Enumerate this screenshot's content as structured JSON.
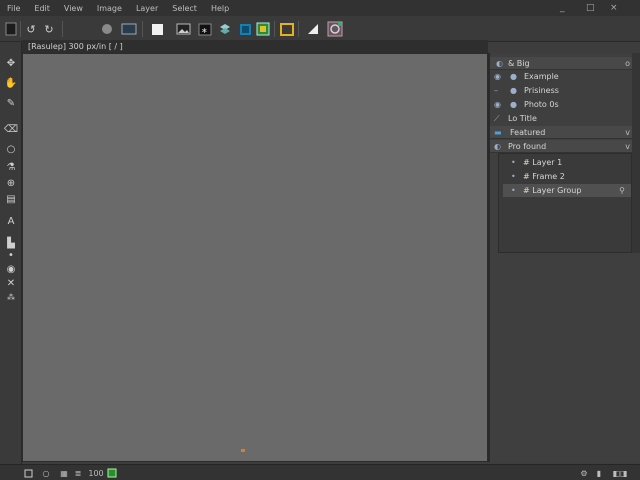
{
  "menubar": {
    "items": [
      "File",
      "Edit",
      "View",
      "Image",
      "Layer",
      "Select",
      "Help"
    ],
    "window_controls": {
      "minimize": "_",
      "maximize": "□",
      "close": "×"
    }
  },
  "toolbar": {
    "icons": [
      "document-icon",
      "undo-icon",
      "redo-icon",
      "sphere-icon",
      "monitor-icon",
      "white-square-icon",
      "image-icon",
      "film-icon",
      "layers-icon",
      "frame-icon",
      "gallery-icon",
      "cursor-icon",
      "spiral-icon"
    ]
  },
  "docinfo": {
    "text": "[Rasulep] 300 px/in [ / ]"
  },
  "tools": {
    "icons": [
      "move-icon",
      "hand-icon",
      "brush-icon",
      "eraser-icon",
      "lasso-icon",
      "dropper-icon",
      "stamp-icon",
      "ruler-icon",
      "text-icon",
      "bucket-icon",
      "dot-icon",
      "circle-target-icon",
      "cross-icon",
      "fx-icon"
    ]
  },
  "panel": {
    "header1": {
      "label": "& Big",
      "icon": "eye-icon",
      "right": "o"
    },
    "rows": [
      {
        "label": "Example",
        "icon": "eye-icon"
      },
      {
        "label": "Prisiness",
        "icon": "eye-icon"
      },
      {
        "label": "Photo 0s",
        "icon": "eye-icon"
      },
      {
        "label": "Lo Title",
        "icon": "link-icon"
      }
    ],
    "header2": {
      "label": "Featured",
      "right": "v"
    },
    "header3": {
      "label": "Pro found",
      "right": "v"
    },
    "subitems": [
      {
        "label": "# Layer 1"
      },
      {
        "label": "# Frame 2"
      },
      {
        "label": "# Layer Group"
      }
    ]
  },
  "statusbar": {
    "zoom": "100",
    "status_icons": [
      "square-icon",
      "circle-icon",
      "grid-icon",
      "layers-small-icon",
      "green-box-icon",
      "gear-small-icon",
      "lock-small-icon"
    ]
  }
}
